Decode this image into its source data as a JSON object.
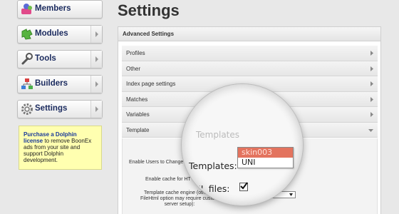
{
  "sidebar": {
    "items": [
      {
        "label": "Members",
        "icon": "members-icon"
      },
      {
        "label": "Modules",
        "icon": "puzzle-icon"
      },
      {
        "label": "Tools",
        "icon": "wrench-icon"
      },
      {
        "label": "Builders",
        "icon": "builders-icon"
      },
      {
        "label": "Settings",
        "icon": "gear-icon"
      }
    ],
    "promo": {
      "link": "Purchase a Dolphin license",
      "text": "to remove BoonEx ads from your site and support Dolphin development."
    }
  },
  "main": {
    "title": "Settings",
    "panel_title": "Advanced Settings",
    "sections": [
      "Profiles",
      "Other",
      "Index page settings",
      "Matches",
      "Variables",
      "Template"
    ],
    "form": {
      "enable_users_label": "Enable Users to Change",
      "enable_cache_label": "Enable cache for HT",
      "cache_engine_label_1": "Template cache engine (other th",
      "cache_engine_label_2": "FileHtml option may require custom",
      "cache_engine_label_3": "server setup):"
    },
    "magnifier": {
      "templates_label": "Templates:",
      "options": [
        "skin003",
        "UNI"
      ],
      "selected_option": "skin003",
      "ghost_text": "Templates",
      "html_files_label": "ML files:",
      "html_files_checked": true
    }
  },
  "colors": {
    "nav_text": "#1a2a5e",
    "promo_bg": "#ffffb0",
    "selected_option_bg": "#e3735e"
  }
}
